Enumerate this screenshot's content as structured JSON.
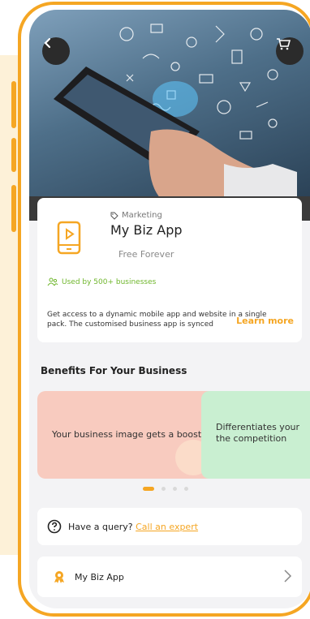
{
  "colors": {
    "accent": "#f5a623",
    "green": "#6fb62c",
    "card_pink": "#f8cbbf",
    "card_green": "#c9efd1"
  },
  "nav": {
    "back_icon": "chevron-left-icon",
    "cart_icon": "cart-icon"
  },
  "product": {
    "category_icon": "tag-icon",
    "category": "Marketing",
    "name": "My Biz App",
    "price": "Free Forever",
    "used_icon": "users-icon",
    "used_by": "Used by 500+ businesses",
    "description": "Get access to a dynamic mobile app and website in a single pack. The customised business app is synced",
    "learn_more": "Learn more"
  },
  "benefits": {
    "title": "Benefits For Your Business",
    "items": [
      {
        "text": "Your business image gets a boost"
      },
      {
        "text": "Differentiates your the competition"
      }
    ],
    "pager": {
      "count": 4,
      "active": 0
    }
  },
  "query": {
    "icon": "question-icon",
    "prefix": "Have a query? ",
    "link": "Call an expert"
  },
  "biz_row": {
    "icon": "badge-icon",
    "label": "My Biz App",
    "chevron": "chevron-right-icon"
  }
}
